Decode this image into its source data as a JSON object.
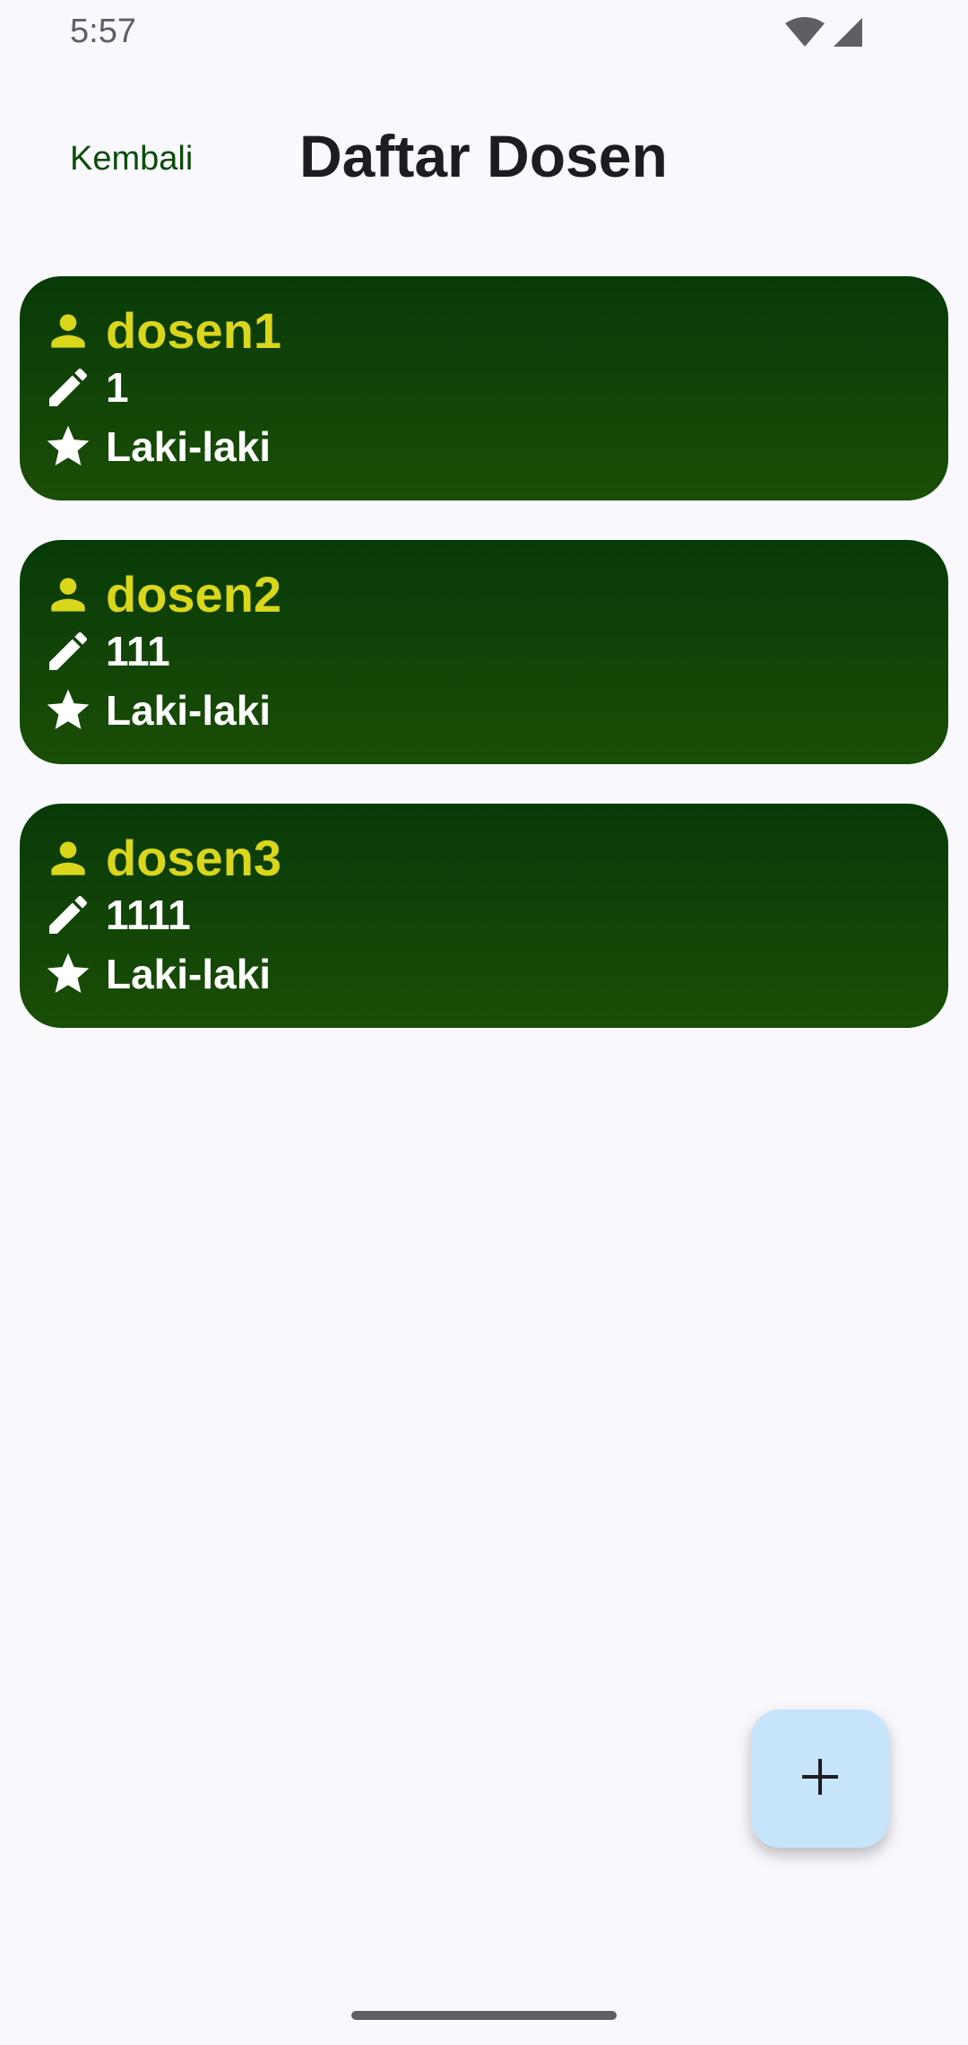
{
  "status_bar": {
    "time": "5:57",
    "icons": [
      "wifi-icon",
      "cell-signal-icon"
    ]
  },
  "app_bar": {
    "back_label": "Kembali",
    "title": "Daftar Dosen"
  },
  "colors": {
    "background": "#f9f8fd",
    "card_gradient_top": "#083a08",
    "card_gradient_bottom": "#1a4e06",
    "name_text": "#d9d61c",
    "value_text": "#ffffff",
    "fab_background": "#c6e5fb",
    "back_label": "#0b4d0b"
  },
  "dosen_list": [
    {
      "name": "dosen1",
      "nip": "1",
      "gender": "Laki-laki",
      "icons": [
        "person-icon",
        "pencil-icon",
        "star-icon"
      ]
    },
    {
      "name": "dosen2",
      "nip": "111",
      "gender": "Laki-laki",
      "icons": [
        "person-icon",
        "pencil-icon",
        "star-icon"
      ]
    },
    {
      "name": "dosen3",
      "nip": "1111",
      "gender": "Laki-laki",
      "icons": [
        "person-icon",
        "pencil-icon",
        "star-icon"
      ]
    }
  ],
  "fab": {
    "icon": "plus-icon"
  }
}
